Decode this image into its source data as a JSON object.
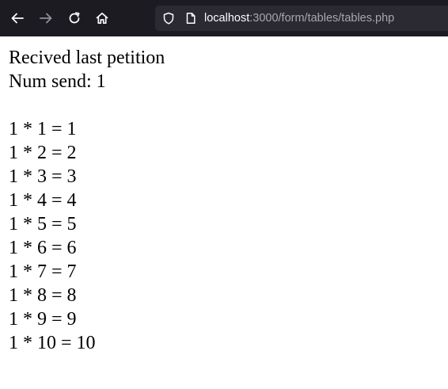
{
  "browser": {
    "url_host": "localhost",
    "url_rest": ":3000/form/tables/tables.php",
    "icons": {
      "back": "arrow-left-icon",
      "forward": "arrow-right-icon",
      "reload": "reload-icon",
      "home": "home-icon",
      "tracking_protection": "shield-icon",
      "page_info": "page-icon"
    }
  },
  "content": {
    "heading": "Recived last petition",
    "num_send": "Num send: 1",
    "table": [
      "1 * 1 = 1",
      "1 * 2 = 2",
      "1 * 3 = 3",
      "1 * 4 = 4",
      "1 * 5 = 5",
      "1 * 6 = 6",
      "1 * 7 = 7",
      "1 * 8 = 8",
      "1 * 9 = 9",
      "1 * 10 = 10"
    ]
  }
}
